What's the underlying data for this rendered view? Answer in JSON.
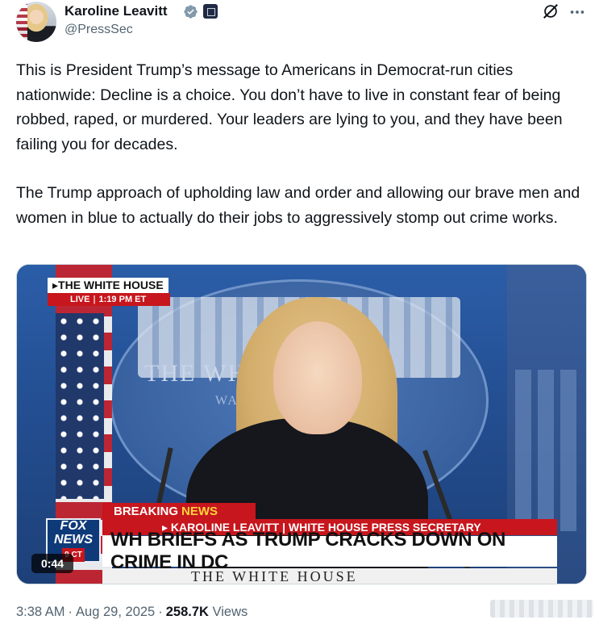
{
  "author": {
    "name": "Karoline Leavitt",
    "handle": "@PressSec"
  },
  "tweet": {
    "paragraphs": [
      "This is President Trump’s message to Americans in Democrat-run cities nationwide: Decline is a choice. You don’t have to live in constant fear of being robbed, raped, or murdered. Your leaders are lying to you, and they have been failing you for decades.",
      "The Trump approach of upholding law and order and allowing our brave men and women in blue to actually do their jobs to aggressively stomp out crime works."
    ]
  },
  "video": {
    "location_tag": "▸THE WHITE HOUSE",
    "live_label": "LIVE",
    "live_time": "1:19 PM ET",
    "seal_text": "THE WH    USE",
    "seal_subtext": "WA",
    "breaking_label": "BREAKING",
    "breaking_news": "NEWS",
    "network_logo_line1": "FOX",
    "network_logo_line2": "NEWS",
    "network_logo_line3": "9 CT",
    "subhead": "▸ KAROLINE LEAVITT | WHITE HOUSE PRESS SECRETARY",
    "headline": "WH BRIEFS AS TRUMP CRACKS DOWN ON CRIME IN DC",
    "lower_band": "THE WHITE HOUSE",
    "duration": "0:44"
  },
  "meta": {
    "time": "3:38 AM",
    "date": "Aug 29, 2025",
    "views_count": "258.7K",
    "views_label": "Views"
  },
  "icons": {
    "verified": "verified-badge-icon",
    "gov": "government-affiliation-icon",
    "grok": "grok-icon",
    "more": "more-options-icon"
  },
  "colors": {
    "verified_blue": "#1d9bf0",
    "fox_red": "#c7161d",
    "muted_text": "#536471"
  }
}
